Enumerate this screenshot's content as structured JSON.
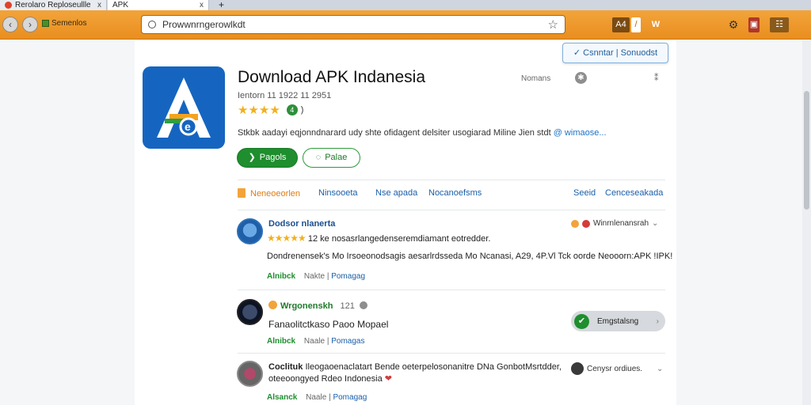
{
  "browser": {
    "tabs": [
      {
        "label": "Rerolaro Reploseullle",
        "close": "x"
      },
      {
        "label": "APK",
        "close": "x"
      },
      {
        "label": "+"
      }
    ],
    "nav_back": "‹",
    "nav_forward": "›",
    "bookmarks_label": "Semenlos",
    "url": "Prowwnrngerowlkdt",
    "toolbar_icons": [
      "A4",
      "/",
      "W",
      "⚙",
      "▣",
      "☷"
    ]
  },
  "popup": {
    "text": "✓ Csnntar  |  Sonuodst"
  },
  "app": {
    "title": "Download APK Indanesia",
    "meta": "Ientorn 11 1922 11 2951",
    "stars": "★★★★",
    "rating_badge": "4",
    "rating_count": ")",
    "header_right_label": "Nomans",
    "header_right_icon": "✱",
    "header_right_more": "⁑",
    "description": "Stkbk aadayi eqjonndnarard udy shte ofidagent delsiter usogiarad Miline Jien stdt",
    "description_more": "@ wimaose...",
    "primary_button": "Pagols",
    "secondary_button": "Palae",
    "accent_color": "#1e8e2e",
    "icon_color": "#1565c0"
  },
  "tabs": {
    "items": [
      {
        "label": "Neneoeorlen"
      },
      {
        "label": "Ninsooeta"
      },
      {
        "label": "Nse apada"
      },
      {
        "label": "Nocanoefsms"
      }
    ],
    "right_items": [
      {
        "label": "Seeid"
      },
      {
        "label": "Cenceseakada"
      }
    ]
  },
  "reviews": [
    {
      "name": "Dodsor nlanerta",
      "stars": "★★★★★",
      "summary": "12 ke nosasrlangedenseremdiamant eotredder.",
      "body": "Dondrenensek's Mo Irsoeonodsagis aesarlrdsseda Mo Ncanasi, A29, 4P.Vl Tck oorde Neooorn:APK !IPK!",
      "side_label": "Winrnlenansrah",
      "chevron": "⌄",
      "like": "Alnibck",
      "count": "Nakte",
      "reply": "Pomagag"
    },
    {
      "name": "Wrgonenskh",
      "meta": "121",
      "summary": "Fanaolitctkaso Paoo Mopael",
      "pill_label": "Emgstalsng",
      "pill_chevron": "›",
      "like": "Alnibck",
      "count": "Naale",
      "reply": "Pomagas"
    },
    {
      "name": "Coclituk",
      "body": "Ileogaoenaclatart Bende oeterpelosonanitre DNa GonbotMsrtdder,",
      "body2": "oteeoongyed Rdeo Indonesia",
      "side_label": "Cenysr ordiues.",
      "chevron": "⌄",
      "like": "Alsanck",
      "count": "Naale",
      "reply": "Pomagag"
    }
  ]
}
